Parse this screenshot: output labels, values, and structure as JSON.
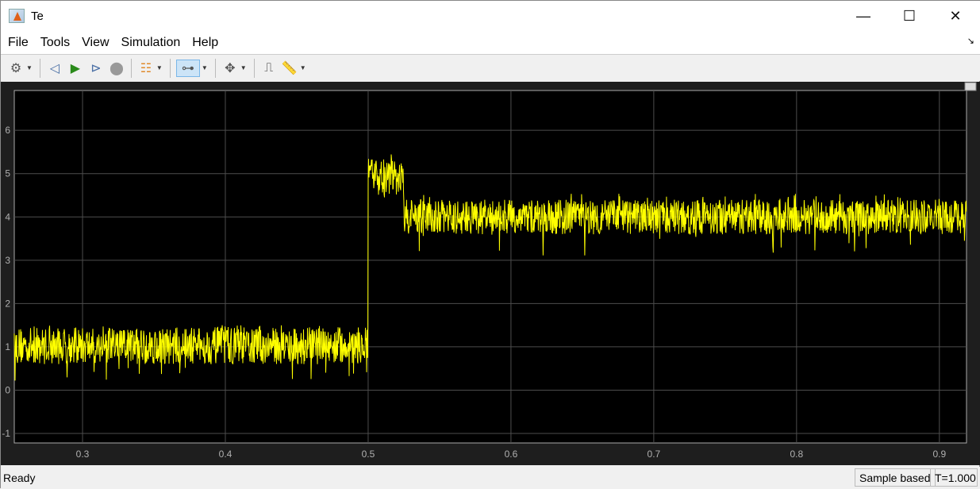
{
  "window": {
    "title": "Te",
    "minimize": "—",
    "maximize": "☐",
    "close": "✕"
  },
  "menu": [
    "File",
    "Tools",
    "View",
    "Simulation",
    "Help"
  ],
  "toolbar": {
    "icons": [
      "gear-icon",
      "step-back-icon",
      "run-icon",
      "step-forward-icon",
      "stop-icon",
      "signal-hierarchy-icon",
      "zoom-x-icon",
      "zoom-fit-icon",
      "triggers-icon",
      "measurement-icon"
    ]
  },
  "status": {
    "text": "Ready",
    "mode": "Sample based",
    "time": "T=1.000"
  },
  "colors": {
    "background": "#000000",
    "signal": "#ffff00",
    "grid": "#4d4d4d",
    "axes": "#1e1e1e",
    "ticks": "#b0b0b0"
  },
  "chart_data": {
    "type": "line",
    "title": "",
    "xlim": [
      0.2522,
      0.919
    ],
    "ylim": [
      -1.22,
      6.92
    ],
    "grid": true,
    "xticks": [
      0.3,
      0.4,
      0.5,
      0.6,
      0.7,
      0.8,
      0.9
    ],
    "xtick_labels": [
      "0.3",
      "0.4",
      "0.5",
      "0.6",
      "0.7",
      "0.8",
      "0.9"
    ],
    "yticks": [
      -1,
      0,
      1,
      2,
      3,
      4,
      5,
      6
    ],
    "ytick_labels": [
      "-1",
      "0",
      "1",
      "2",
      "3",
      "4",
      "5",
      "6"
    ],
    "series": [
      {
        "color": "#ffff00",
        "segments": [
          {
            "x": [
              0.2522,
              0.5
            ],
            "low": 0.6,
            "high": 1.45,
            "min": 0.2,
            "max": 1.5
          },
          {
            "x": [
              0.5,
              0.525
            ],
            "low": 4.5,
            "high": 5.35,
            "min": 4.4,
            "max": 5.45
          },
          {
            "x": [
              0.525,
              0.919
            ],
            "low": 3.6,
            "high": 4.4,
            "min": 3.1,
            "max": 4.55
          }
        ]
      }
    ]
  }
}
